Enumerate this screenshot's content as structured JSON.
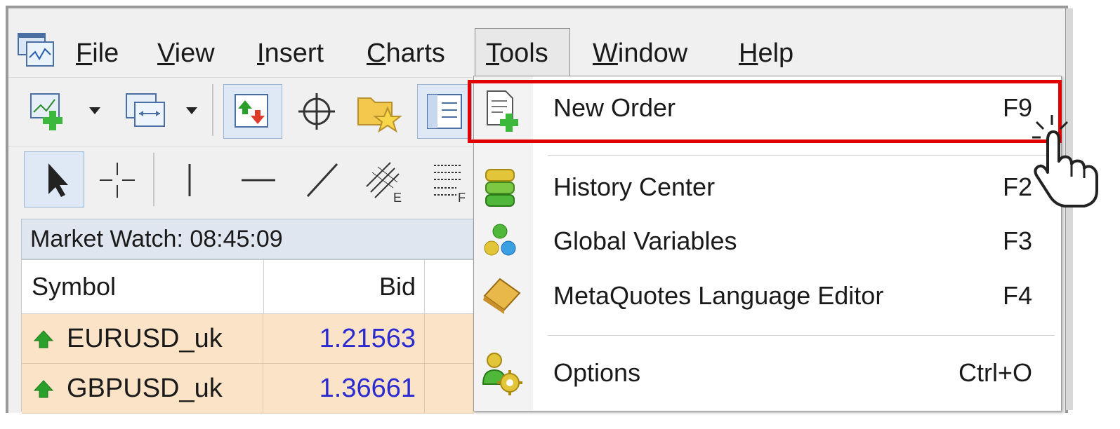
{
  "menubar": {
    "app_icon": "metatrader-app-icon",
    "items": [
      {
        "label_first": "F",
        "label_rest": "ile",
        "name": "File"
      },
      {
        "label_first": "V",
        "label_rest": "iew",
        "name": "View"
      },
      {
        "label_first": "I",
        "label_rest": "nsert",
        "name": "Insert"
      },
      {
        "label_first": "C",
        "label_rest": "harts",
        "name": "Charts"
      },
      {
        "label_first": "T",
        "label_rest": "ools",
        "name": "Tools"
      },
      {
        "label_first": "W",
        "label_rest": "indow",
        "name": "Window"
      },
      {
        "label_first": "H",
        "label_rest": "elp",
        "name": "Help"
      }
    ],
    "active_item": "Tools"
  },
  "toolbar1": {
    "icons": [
      "new-chart-icon",
      "dropdown-arrow-icon",
      "profiles-icon",
      "dropdown-arrow-icon",
      "market-watch-icon",
      "crosshair-icon",
      "favorites-folder-icon",
      "navigator-icon"
    ]
  },
  "toolbar2": {
    "icons": [
      "cursor-icon",
      "crosshair-line-icon",
      "vertical-line-icon",
      "horizontal-line-icon",
      "trendline-icon",
      "equidistant-channel-icon",
      "fibonacci-icon"
    ],
    "sub_labels": {
      "channel": "E",
      "fibo": "F"
    }
  },
  "market_watch": {
    "title": "Market Watch: 08:45:09",
    "columns": [
      "Symbol",
      "Bid"
    ],
    "rows": [
      {
        "symbol": "EURUSD_uk",
        "bid": "1.21563",
        "direction": "up"
      },
      {
        "symbol": "GBPUSD_uk",
        "bid": "1.36661",
        "direction": "up"
      }
    ]
  },
  "tools_menu": {
    "items": [
      {
        "label": "New Order",
        "shortcut": "F9",
        "icon": "new-order-icon",
        "highlighted": true
      },
      {
        "label": "History Center",
        "shortcut": "F2",
        "icon": "history-center-icon"
      },
      {
        "label": "Global Variables",
        "shortcut": "F3",
        "icon": "global-variables-icon"
      },
      {
        "label": "MetaQuotes Language Editor",
        "shortcut": "F4",
        "icon": "metaeditor-icon"
      },
      {
        "label": "Options",
        "shortcut": "Ctrl+O",
        "icon": "options-icon"
      }
    ]
  },
  "colors": {
    "highlight_border": "#e00000",
    "row_background": "#fbe3c7",
    "bid_text": "#2a2ad0",
    "up_arrow": "#2aa02a"
  }
}
